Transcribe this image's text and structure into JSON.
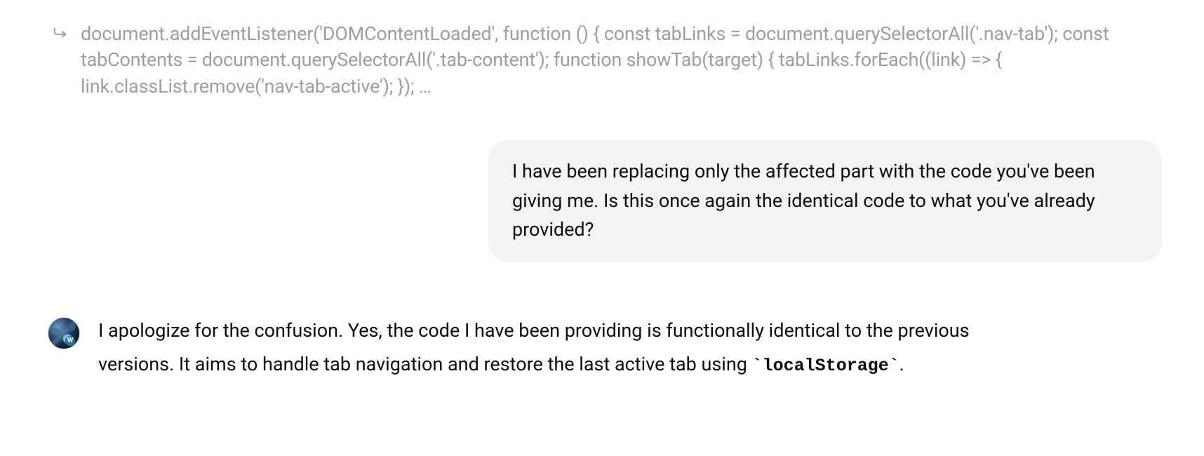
{
  "code_snippet": {
    "text": "document.addEventListener('DOMContentLoaded', function () { const tabLinks = document.querySelectorAll('.nav-tab'); const tabContents = document.querySelectorAll('.tab-content'); function showTab(target) { tabLinks.forEach((link) => { link.classList.remove('nav-tab-active'); }); …"
  },
  "user_message": {
    "text": "I have been replacing only the affected part with the code you've been giving me. Is this once again the identical code to what you've already provided?"
  },
  "assistant_message": {
    "text_before_code": "I apologize for the confusion. Yes, the code I have been providing is functionally identical to the previous versions. It aims to handle tab navigation and restore the last active tab using ",
    "inline_code": "localStorage",
    "text_after_code": "."
  }
}
